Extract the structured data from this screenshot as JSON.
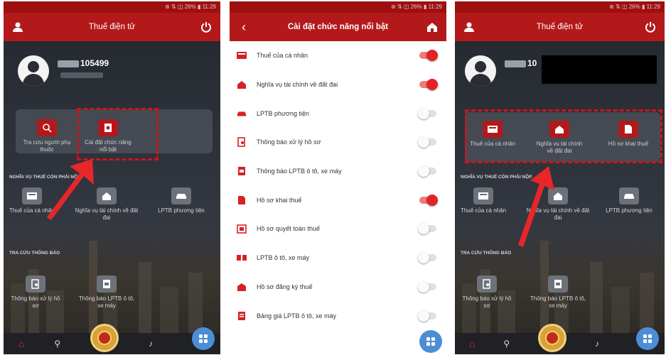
{
  "statusbar": {
    "text": "⊛ ⇅ ◫ 26% ▮ 11:29"
  },
  "screen1": {
    "title": "Thuế điện tử",
    "user_id": "105499",
    "features": [
      {
        "label": "Tra cứu người phụ thuộc",
        "icon": "magnifier-icon"
      },
      {
        "label": "Cài đặt chức năng nổi bật",
        "icon": "settings-doc-icon"
      }
    ],
    "section1": "NGHĨA VỤ THUẾ CÒN PHẢI NỘP",
    "section1_items": [
      "Thuế của cá nhân",
      "Nghĩa vụ tài chính về đất đai",
      "LPTB phương tiện"
    ],
    "section2": "TRA CỨU THÔNG BÁO",
    "section2_items": [
      "Thông báo xử lý hồ sơ",
      "Thông báo LPTB ô tô, xe máy"
    ]
  },
  "screen2": {
    "title": "Cài đặt chức năng nổi bật",
    "items": [
      {
        "label": "Thuế của cá nhân",
        "on": true
      },
      {
        "label": "Nghĩa vụ tài chính về đất đai",
        "on": true
      },
      {
        "label": "LPTB phương tiện",
        "on": false
      },
      {
        "label": "Thông báo xử lý hồ sơ",
        "on": false
      },
      {
        "label": "Thông báo LPTB ô tô, xe máy",
        "on": false
      },
      {
        "label": "Hồ sơ khai thuế",
        "on": true
      },
      {
        "label": "Hồ sơ quyết toán thuế",
        "on": false
      },
      {
        "label": "LPTB ô tô, xe máy",
        "on": false
      },
      {
        "label": "Hồ sơ đăng ký thuế",
        "on": false
      },
      {
        "label": "Bảng giá LPTB ô tô, xe máy",
        "on": false
      }
    ]
  },
  "screen3": {
    "title": "Thuế điện tử",
    "user_id": "10",
    "features": [
      "Thuế của cá nhân",
      "Nghĩa vụ tài chính về đất đai",
      "Hồ sơ khai thuế"
    ],
    "section1": "NGHĨA VỤ THUẾ CÒN PHẢI NỘP",
    "section1_items": [
      "Thuế của cá nhân",
      "Nghĩa vụ tài chính về đất đai",
      "LPTB phương tiện"
    ],
    "section2": "TRA CỨU THÔNG BÁO",
    "section2_items": [
      "Thông báo xử lý hồ sơ",
      "Thông báo LPTB ô tô, xe máy"
    ]
  },
  "colors": {
    "brand_red": "#b3191b",
    "toggle_on": "#e22524",
    "fab_blue": "#4c8ed6",
    "highlight": "#d0141a"
  }
}
